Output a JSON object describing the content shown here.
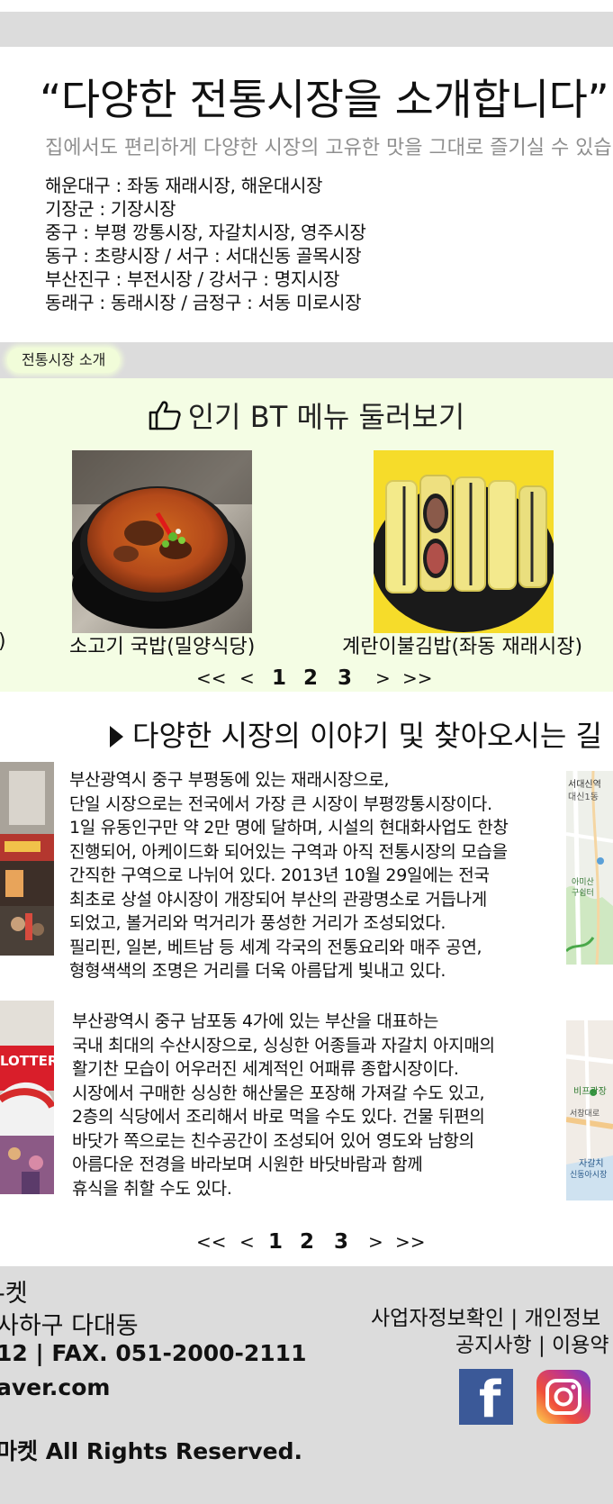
{
  "intro": {
    "title": "“다양한 전통시장을 소개합니다”",
    "subtitle": "집에서도 편리하게 다양한 시장의 고유한 맛을 그대로 즐기실 수 있습니다",
    "markets": [
      "해운대구 : 좌동 재래시장, 해운대시장",
      "기장군 : 기장시장",
      "중구 : 부평 깡통시장, 자갈치시장, 영주시장",
      "동구 : 초량시장  /  서구 : 서대신동 골목시장",
      "부산진구 : 부전시장  /  강서구 : 명지시장",
      "동래구 : 동래시장  /  금정구 : 서동 미로시장"
    ]
  },
  "section_label": "전통시장 소개",
  "popular": {
    "title": "인기 BT 메뉴 둘러보기",
    "partial_caption": ")",
    "items": [
      {
        "caption": "소고기 국밥(밀양식당)"
      },
      {
        "caption": "계란이불김밥(좌동 재래시장)"
      }
    ],
    "pager": {
      "first": "<<",
      "prev": "<",
      "pages": [
        "1",
        "2",
        "3"
      ],
      "next": ">",
      "last": ">>"
    }
  },
  "stories": {
    "title": "다양한 시장의 이야기 및 찾아오시는 길",
    "items": [
      {
        "lines": [
          "부산광역시 중구 부평동에 있는 재래시장으로,",
          "단일 시장으로는 전국에서 가장 큰 시장이 부평깡통시장이다.",
          "1일 유동인구만 약 2만 명에 달하며, 시설의 현대화사업도 한창",
          "진행되어, 아케이드화 되어있는 구역과 아직 전통시장의 모습을",
          "간직한 구역으로 나뉘어 있다. 2013년 10월 29일에는 전국",
          "최초로 상설 야시장이 개장되어 부산의 관광명소로 거듭나게",
          "되었고, 볼거리와 먹거리가 풍성한 거리가 조성되었다.",
          "필리핀, 일본, 베트남 등 세계 각국의 전통요리와 매주 공연,",
          "형형색색의 조명은 거리를 더욱 아름답게 빛내고 있다."
        ]
      },
      {
        "lines": [
          "부산광역시 중구 남포동 4가에 있는 부산을 대표하는",
          "국내 최대의 수산시장으로, 싱싱한 어종들과 자갈치 아지매의",
          "활기찬 모습이 어우러진 세계적인 어패류 종합시장이다.",
          "시장에서 구매한 싱싱한 해산물은 포장해 가져갈 수도 있고,",
          "2층의 식당에서 조리해서 바로 먹을 수도 있다. 건물 뒤편의",
          "바닷가 쪽으로는 친수공간이 조성되어 있어 영도와 남항의",
          "아름다운 전경을 바라보며 시원한 바닷바람과 함께",
          "휴식을 취할 수도 있다."
        ]
      }
    ],
    "map1_labels": [
      "서대신역",
      "대신1동",
      "아미산",
      "구쉼터"
    ],
    "map2_labels": [
      "비프광장",
      "서창대로",
      "자갈치",
      "신동아시장"
    ],
    "photo2_sign": "LOTTER",
    "pager": {
      "first": "<<",
      "prev": "<",
      "pages": [
        "1",
        "2",
        "3"
      ],
      "next": ">",
      "last": ">>"
    }
  },
  "footer": {
    "brand": "-켓",
    "address": "사하구 다대동",
    "phone": "12  |  FAX. 051-2000-2111",
    "email": "aver.com",
    "copyright": "마켓 All Rights Reserved.",
    "links_row1": "사업자정보확인  |  개인정보",
    "links_row2": "공지사항  |  이용약",
    "facebook_icon": "f"
  },
  "colors": {
    "gray_band": "#dcdcdc",
    "popular_bg": "#f4fde4",
    "pill_bg": "#f1fcd9",
    "facebook": "#3b5998",
    "subtitle": "#8f8f8f"
  }
}
